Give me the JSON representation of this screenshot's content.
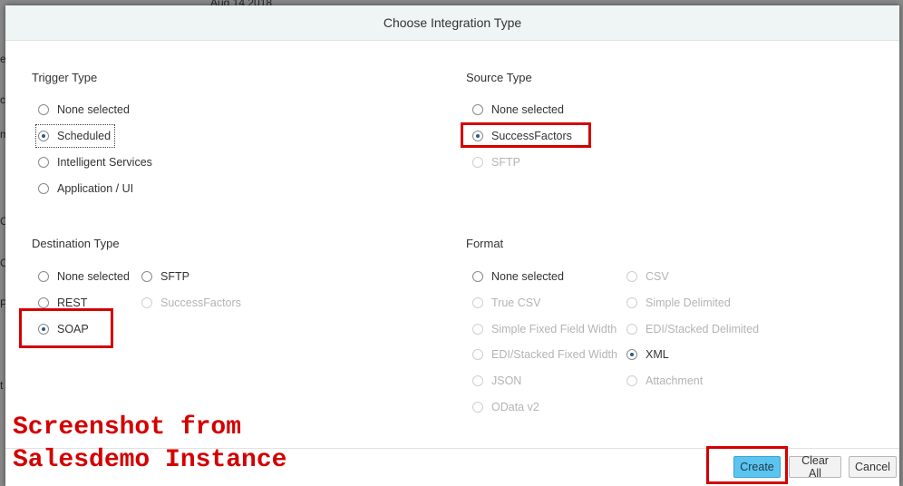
{
  "background": {
    "date_text": "Aug 14 2018",
    "edge_chars": [
      "e",
      "c",
      "m",
      "C",
      "C",
      "P",
      "t"
    ]
  },
  "dialog": {
    "title": "Choose Integration Type"
  },
  "trigger_type": {
    "title": "Trigger Type",
    "options": [
      "None selected",
      "Scheduled",
      "Intelligent Services",
      "Application / UI"
    ],
    "selected": "Scheduled"
  },
  "source_type": {
    "title": "Source Type",
    "options": [
      "None selected",
      "SuccessFactors",
      "SFTP"
    ],
    "selected": "SuccessFactors"
  },
  "destination_type": {
    "title": "Destination Type",
    "options": [
      "None selected",
      "SFTP",
      "REST",
      "SuccessFactors",
      "SOAP"
    ],
    "selected": "SOAP"
  },
  "format": {
    "title": "Format",
    "options": [
      "None selected",
      "CSV",
      "True CSV",
      "Simple Delimited",
      "Simple Fixed Field Width",
      "EDI/Stacked Delimited",
      "EDI/Stacked Fixed Width",
      "XML",
      "JSON",
      "Attachment",
      "OData v2"
    ],
    "selected": "XML"
  },
  "buttons": {
    "create": "Create",
    "clear_all": "Clear All",
    "cancel": "Cancel"
  },
  "watermark": {
    "line1": "Screenshot from",
    "line2": "Salesdemo Instance"
  },
  "colors": {
    "header_bg": "#eff4f4",
    "accent_radio": "#2b5b84",
    "primary_button": "#5bc4ef",
    "annotation_red": "#d40000"
  }
}
